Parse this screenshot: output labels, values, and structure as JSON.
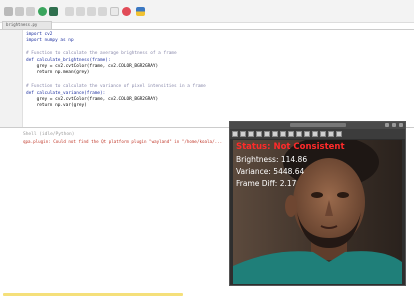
{
  "editor": {
    "tab_label": "brightness.py",
    "lines": [
      {
        "text": "import cv2",
        "type": "code"
      },
      {
        "text": "import numpy as np",
        "type": "code"
      },
      {
        "text": "",
        "type": "code"
      },
      {
        "text": "# Function to calculate the average brightness of a frame",
        "type": "comment"
      },
      {
        "text": "def calculate_brightness(frame):",
        "type": "def"
      },
      {
        "text": "    grey = cv2.cvtColor(frame, cv2.COLOR_BGR2GRAY)",
        "type": "code"
      },
      {
        "text": "    return np.mean(grey)",
        "type": "code"
      },
      {
        "text": "",
        "type": "code"
      },
      {
        "text": "# Function to calculate the variance of pixel intensities in a frame",
        "type": "comment"
      },
      {
        "text": "def calculate_variance(frame):",
        "type": "def"
      },
      {
        "text": "    grey = cv2.cvtColor(frame, cv2.COLOR_BGR2GRAY)",
        "type": "code"
      },
      {
        "text": "    return np.var(grey)",
        "type": "code"
      }
    ]
  },
  "shell": {
    "title": "Shell (idle/Python)",
    "error": "qpa.plugin: Could not find the Qt platform plugin \"wayland\" in \"/home/koala/..."
  },
  "video": {
    "status": "Status: Not Consistent",
    "brightness": "Brightness: 114.86",
    "variance": "Variance: 5448.64",
    "frame_diff": "Frame Diff: 2.17"
  },
  "colors": {
    "status_text": "#ff2a2a",
    "overlay_text": "#ffffff",
    "shell_error": "#c0392b",
    "toolbar_run": "#3aa55d",
    "toolbar_stop": "#e14b57"
  }
}
